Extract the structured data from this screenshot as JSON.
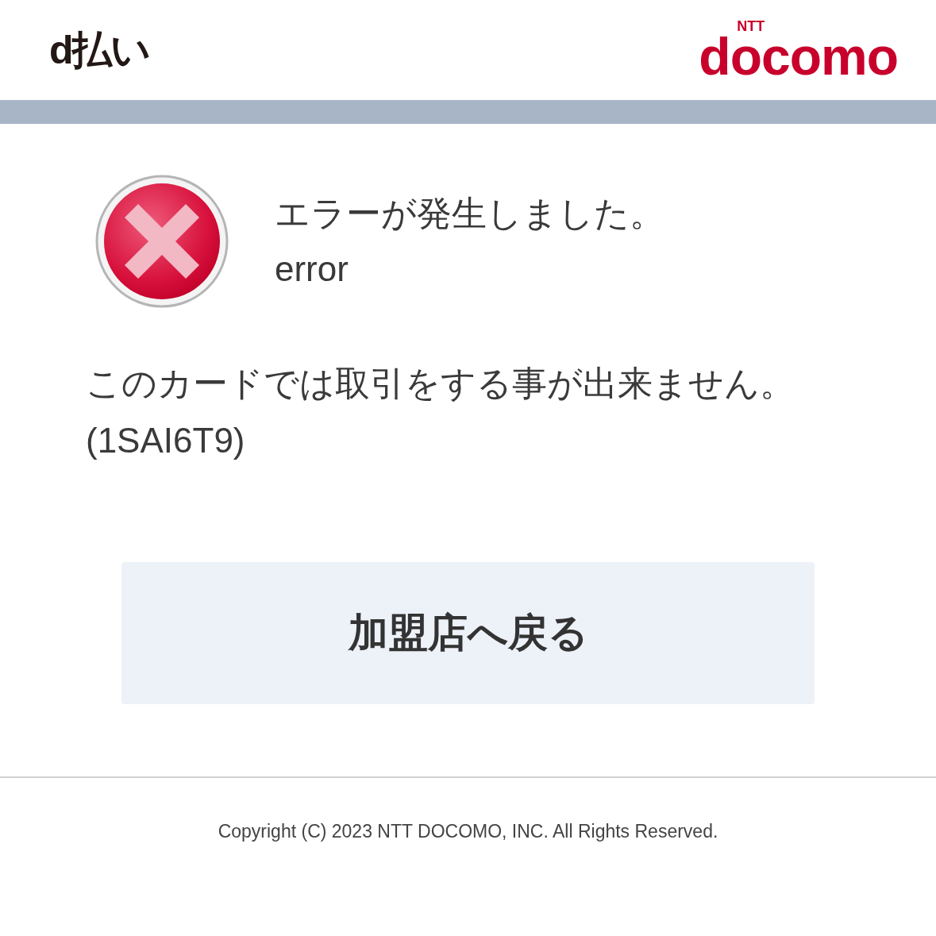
{
  "header": {
    "service_logo": "d払い",
    "brand_logo": {
      "small": "NTT",
      "main": "docomo"
    }
  },
  "error": {
    "title": "エラーが発生しました。",
    "subtitle": "error",
    "message": "このカードでは取引をする事が出来ません。",
    "code": "(1SAI6T9)"
  },
  "button": {
    "label": "加盟店へ戻る"
  },
  "footer": {
    "copyright": "Copyright (C) 2023 NTT DOCOMO, INC. All Rights Reserved."
  }
}
